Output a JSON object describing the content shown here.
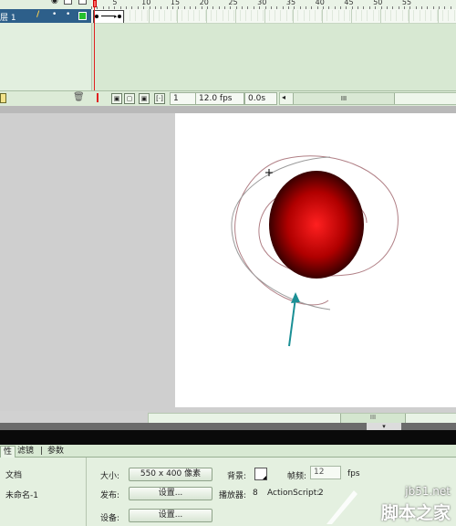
{
  "timeline": {
    "ruler_numbers": [
      "5",
      "10",
      "15",
      "20",
      "25",
      "30",
      "35",
      "40",
      "45",
      "50",
      "55"
    ],
    "layer_name": "层 1",
    "layer_controls": [
      "/",
      "•",
      "•",
      "■"
    ],
    "current_frame": "1",
    "frame_rate": "12.0 fps",
    "elapsed_time": "0.0s",
    "scroll_thumb": "III"
  },
  "stage": {
    "background": "#ffffff",
    "ball_color_center": "#ff2020",
    "ball_color_edge": "#1a0000",
    "guide_color": "#b07f85",
    "arrow_color": "#1a8f95",
    "hscroll_thumb": "III"
  },
  "properties": {
    "tabs": [
      "性",
      "滤镜",
      "参数"
    ],
    "doc_type": "文档",
    "doc_name": "未命名-1",
    "size_label": "大小:",
    "size_value": "550 x 400 像素",
    "bg_label": "背景:",
    "fps_label": "帧频:",
    "fps_value": "12",
    "fps_unit": "fps",
    "publish_label": "发布:",
    "settings_label": "设置...",
    "player_label": "播放器:",
    "player_value": "8",
    "as_label": "ActionScript:",
    "as_value": "2",
    "device_label": "设备:",
    "device_settings_label": "设置..."
  },
  "watermark": {
    "site": "jb51.net",
    "text": "脚本之家"
  }
}
